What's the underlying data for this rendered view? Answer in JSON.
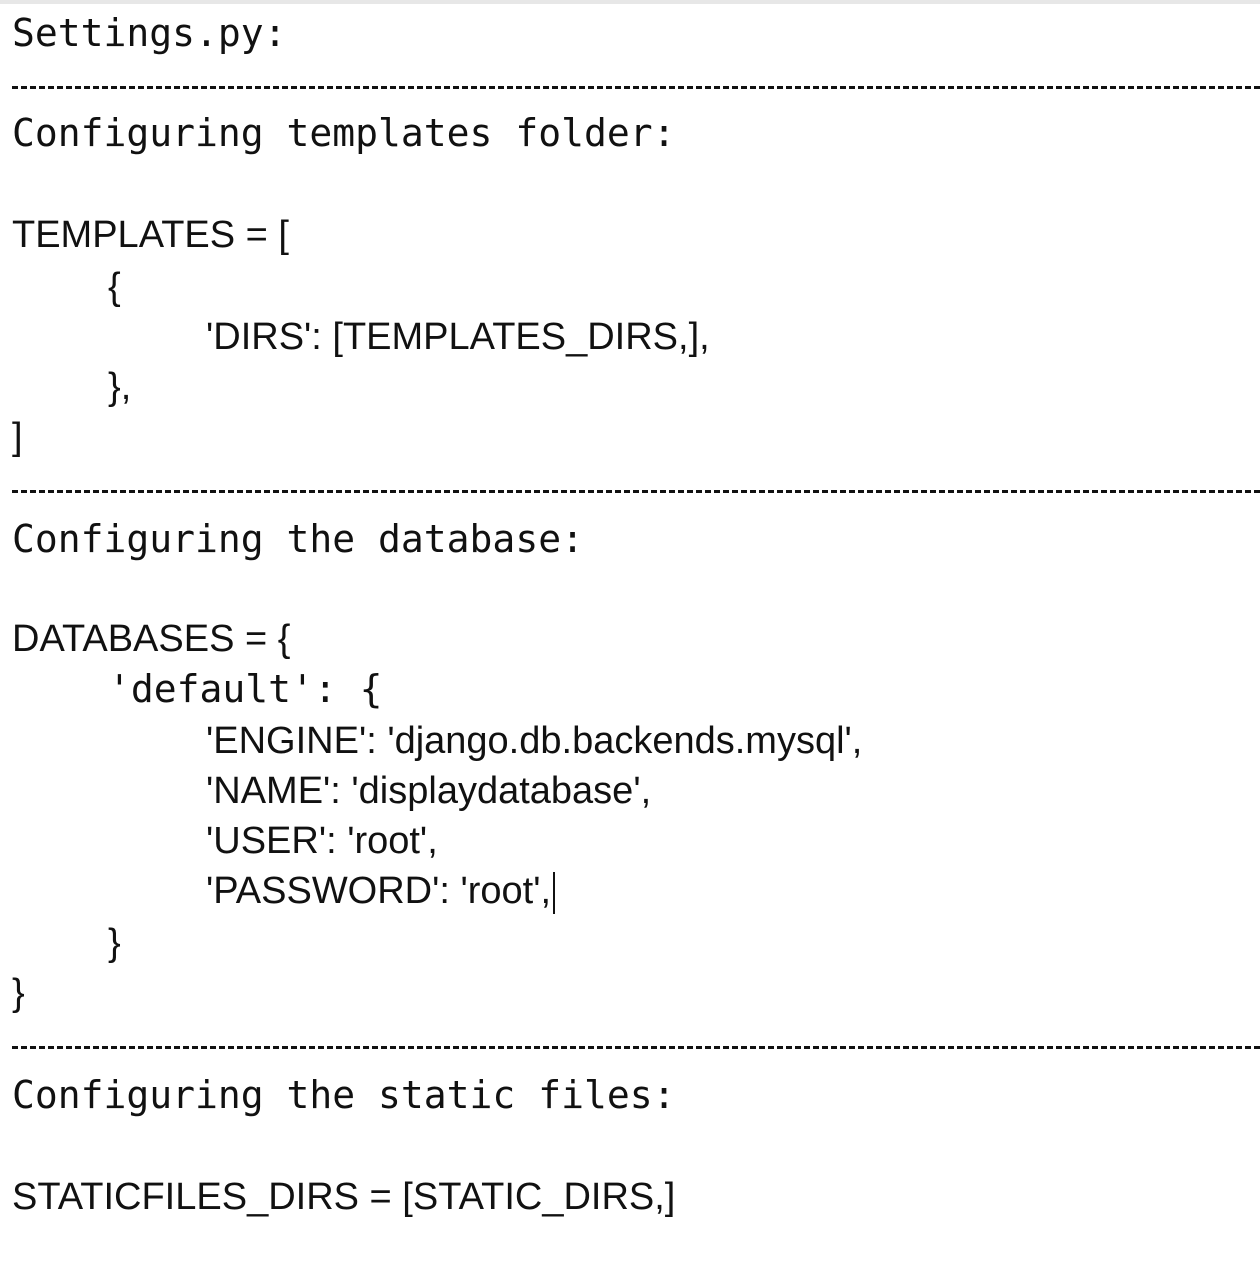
{
  "document": {
    "title": "Settings.py:",
    "divider": "------------------------------------------------------------",
    "section_templates": {
      "heading": "Configuring templates folder:",
      "lines": [
        "TEMPLATES = [",
        "{",
        "'DIRS': [TEMPLATES_DIRS,],",
        "},",
        "]"
      ]
    },
    "section_database": {
      "heading": "Configuring the database:",
      "lines": [
        "DATABASES = {",
        "'default': {",
        "'ENGINE': 'django.db.backends.mysql',",
        "'NAME': 'displaydatabase',",
        "'USER': 'root',",
        "'PASSWORD': 'root',",
        "}",
        "}"
      ]
    },
    "section_static": {
      "heading": "Configuring the static files:",
      "line": "STATICFILES_DIRS = [STATIC_DIRS,]"
    }
  }
}
